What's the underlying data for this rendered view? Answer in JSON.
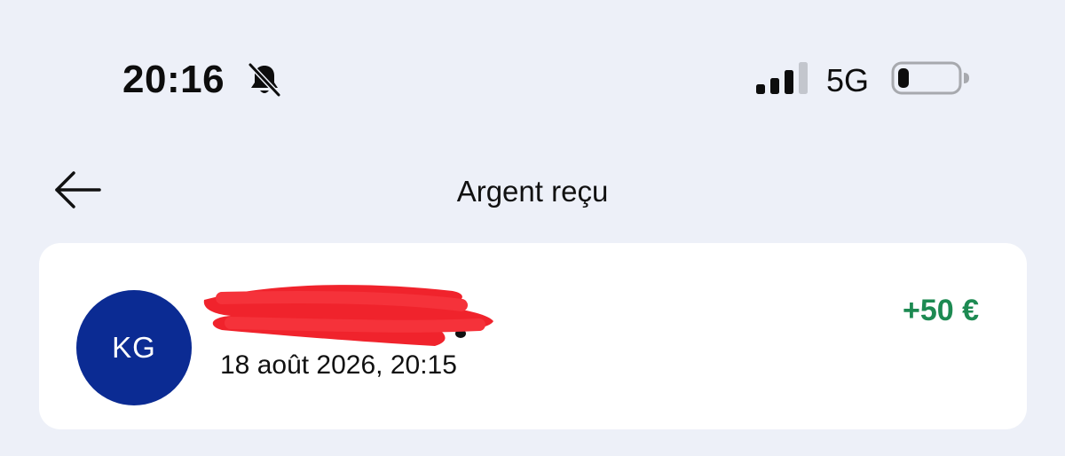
{
  "status_bar": {
    "time": "20:16",
    "network": "5G",
    "icons": [
      "bell-off-icon",
      "signal-icon",
      "battery-icon"
    ],
    "battery_level": 0.15,
    "signal_bars": 3
  },
  "header": {
    "title": "Argent reçu",
    "back_icon": "arrow-left-icon"
  },
  "transaction": {
    "avatar_initials": "KG",
    "avatar_color": "#0b2b93",
    "name_redaction_color": "#f0232c",
    "date": "18 août 2026, 20:15",
    "amount": "+50 €",
    "amount_color": "#1d8a52"
  }
}
